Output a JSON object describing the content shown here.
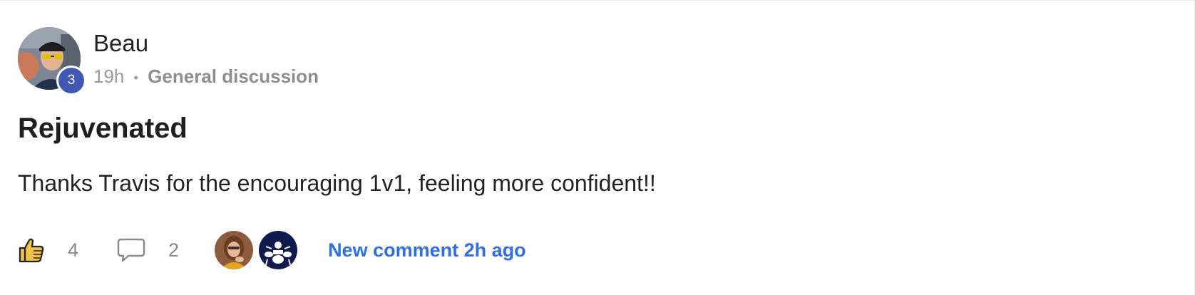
{
  "post": {
    "author": "Beau",
    "level": "3",
    "time_ago": "19h",
    "separator": "•",
    "category": "General discussion",
    "title": "Rejuvenated",
    "body": "Thanks Travis for the encouraging 1v1, feeling more confident!!"
  },
  "actions": {
    "like_icon": "thumbs-up-icon",
    "like_count": "4",
    "comment_icon": "speech-bubble-icon",
    "comment_count": "2",
    "participants": [
      "participant-avatar-woman",
      "participant-avatar-drummer"
    ],
    "new_comment_text": "New comment 2h ago"
  },
  "colors": {
    "level_badge": "#4157b4",
    "link": "#2d6fe6",
    "like_icon_fill": "#f2c04c"
  }
}
